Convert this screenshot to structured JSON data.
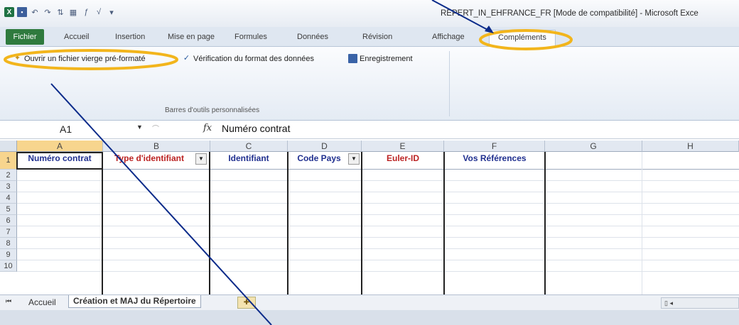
{
  "window": {
    "title": "REPERT_IN_EHFRANCE_FR [Mode de compatibilité] - Microsoft Exce"
  },
  "quick_access": {
    "icons": [
      "excel-logo-icon",
      "save-icon",
      "undo-icon",
      "redo-icon",
      "sort-icon",
      "table-icon",
      "function-icon",
      "filter-icon",
      "customize-icon"
    ]
  },
  "ribbon": {
    "tabs": [
      "Fichier",
      "Accueil",
      "Insertion",
      "Mise en page",
      "Formules",
      "Données",
      "Révision",
      "Affichage",
      "Compléments"
    ],
    "active_tab": "Compléments",
    "buttons": [
      {
        "label": "Ouvrir un fichier vierge pré-formaté",
        "icon": "spark-icon"
      },
      {
        "label": "Vérification du format des données",
        "icon": "check-icon"
      },
      {
        "label": "Enregistrement",
        "icon": "save-icon"
      }
    ],
    "group_label": "Barres d'outils personnalisées"
  },
  "formula_bar": {
    "cell_ref": "A1",
    "fx": "fx",
    "content": "Numéro contrat"
  },
  "grid": {
    "columns": [
      "A",
      "B",
      "C",
      "D",
      "E",
      "F",
      "G",
      "H"
    ],
    "selected_column": "A",
    "rows": [
      "1",
      "2",
      "3",
      "4",
      "5",
      "6",
      "7",
      "8",
      "9",
      "10"
    ],
    "selected_row": "1",
    "headers": {
      "A": "Numéro contrat",
      "B": "Type d'identifiant",
      "C": "Identifiant",
      "D": "Code Pays",
      "E": "Euler-ID",
      "F": "Vos Références"
    },
    "header_colors": {
      "blue": "#1f2f8f",
      "red": "#b22222"
    }
  },
  "sheets": {
    "tabs": [
      "Accueil",
      "Création et MAJ du Répertoire"
    ],
    "active": "Création et MAJ du Répertoire"
  },
  "annotation": {
    "highlight_color": "#f2b51c",
    "arrow_color": "#0b2b8a"
  }
}
